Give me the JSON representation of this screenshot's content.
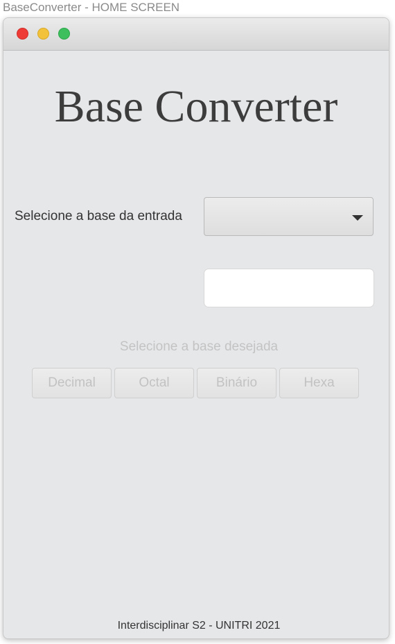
{
  "caption": "BaseConverter - HOME SCREEN",
  "window": {
    "traffic_lights": {
      "close_color": "#ee3b36",
      "minimize_color": "#f2c23a",
      "zoom_color": "#3cbf5c"
    }
  },
  "main": {
    "title": "Base Converter",
    "input_base_label": "Selecione a base da entrada",
    "input_base_select": {
      "selected_value": ""
    },
    "number_input": {
      "value": "",
      "placeholder": ""
    },
    "target_base_label": "Selecione a base desejada",
    "base_buttons": [
      {
        "label": "Decimal",
        "enabled": false
      },
      {
        "label": "Octal",
        "enabled": false
      },
      {
        "label": "Binário",
        "enabled": false
      },
      {
        "label": "Hexa",
        "enabled": false
      }
    ]
  },
  "footer": {
    "text": "Interdisciplinar S2 - UNITRI 2021"
  }
}
